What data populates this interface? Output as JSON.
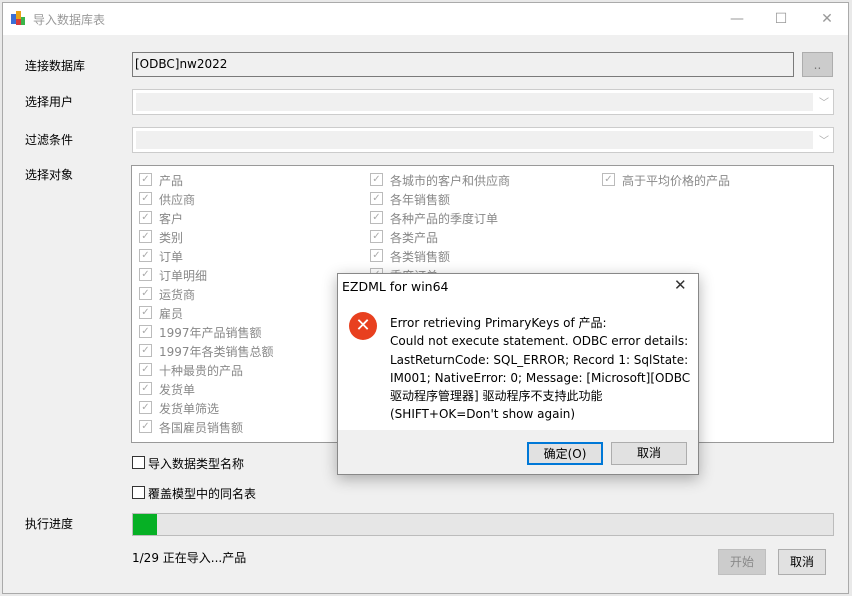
{
  "window": {
    "title": "导入数据库表",
    "minimize": "—",
    "maximize": "☐",
    "close": "✕"
  },
  "form": {
    "db_label": "连接数据库",
    "db_value": "[ODBC]nw2022",
    "browse_label": "..",
    "user_label": "选择用户",
    "user_value": "",
    "filter_label": "过滤条件",
    "filter_value": "",
    "objects_label": "选择对象",
    "objects": {
      "col1": [
        "产品",
        "供应商",
        "客户",
        "类别",
        "订单",
        "订单明细",
        "运货商",
        "雇员",
        "1997年产品销售额",
        "1997年各类销售总额",
        "十种最贵的产品",
        "发货单",
        "发货单筛选",
        "各国雇员销售额"
      ],
      "col2": [
        "各城市的客户和供应商",
        "各年销售额",
        "各种产品的季度订单",
        "各类产品",
        "各类销售额",
        "季度订单"
      ],
      "col3": [
        "高于平均价格的产品"
      ],
      "all_checked": true
    },
    "import_type_names": {
      "label": "导入数据类型名称",
      "checked": false
    },
    "overwrite_tables": {
      "label": "覆盖模型中的同名表",
      "checked": false
    },
    "progress_label": "执行进度",
    "progress": {
      "current": 1,
      "total": 29,
      "color": "#06b025"
    },
    "status_text": "1/29 正在导入...产品",
    "start_button": "开始",
    "cancel_button": "取消"
  },
  "dialog": {
    "title": "EZDML for win64",
    "icon": "error-icon",
    "message_lines": [
      "Error retrieving PrimaryKeys of 产品:",
      "Could not execute statement. ODBC error details:",
      "LastReturnCode: SQL_ERROR; Record 1: SqlState:",
      "IM001; NativeError: 0; Message: [Microsoft][ODBC",
      "驱动程序管理器] 驱动程序不支持此功能",
      "(SHIFT+OK=Don't show again)"
    ],
    "ok_button": "确定(O)",
    "cancel_button": "取消"
  }
}
